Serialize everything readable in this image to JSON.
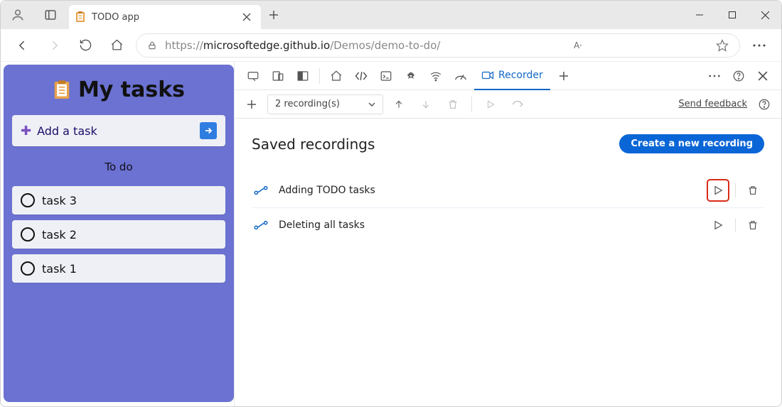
{
  "window": {
    "tab_title": "TODO app"
  },
  "address": {
    "scheme": "https://",
    "host": "microsoftedge.github.io",
    "path": "/Demos/demo-to-do/"
  },
  "app": {
    "title": "My tasks",
    "add_placeholder": "Add a task",
    "section_label": "To do",
    "tasks": [
      {
        "label": "task 3"
      },
      {
        "label": "task 2"
      },
      {
        "label": "task 1"
      }
    ]
  },
  "devtools": {
    "tab_label": "Recorder",
    "recording_count_label": "2 recording(s)",
    "feedback_link": "Send feedback",
    "heading": "Saved recordings",
    "create_button": "Create a new recording",
    "recordings": [
      {
        "name": "Adding TODO tasks",
        "highlight_play": true
      },
      {
        "name": "Deleting all tasks",
        "highlight_play": false
      }
    ]
  }
}
